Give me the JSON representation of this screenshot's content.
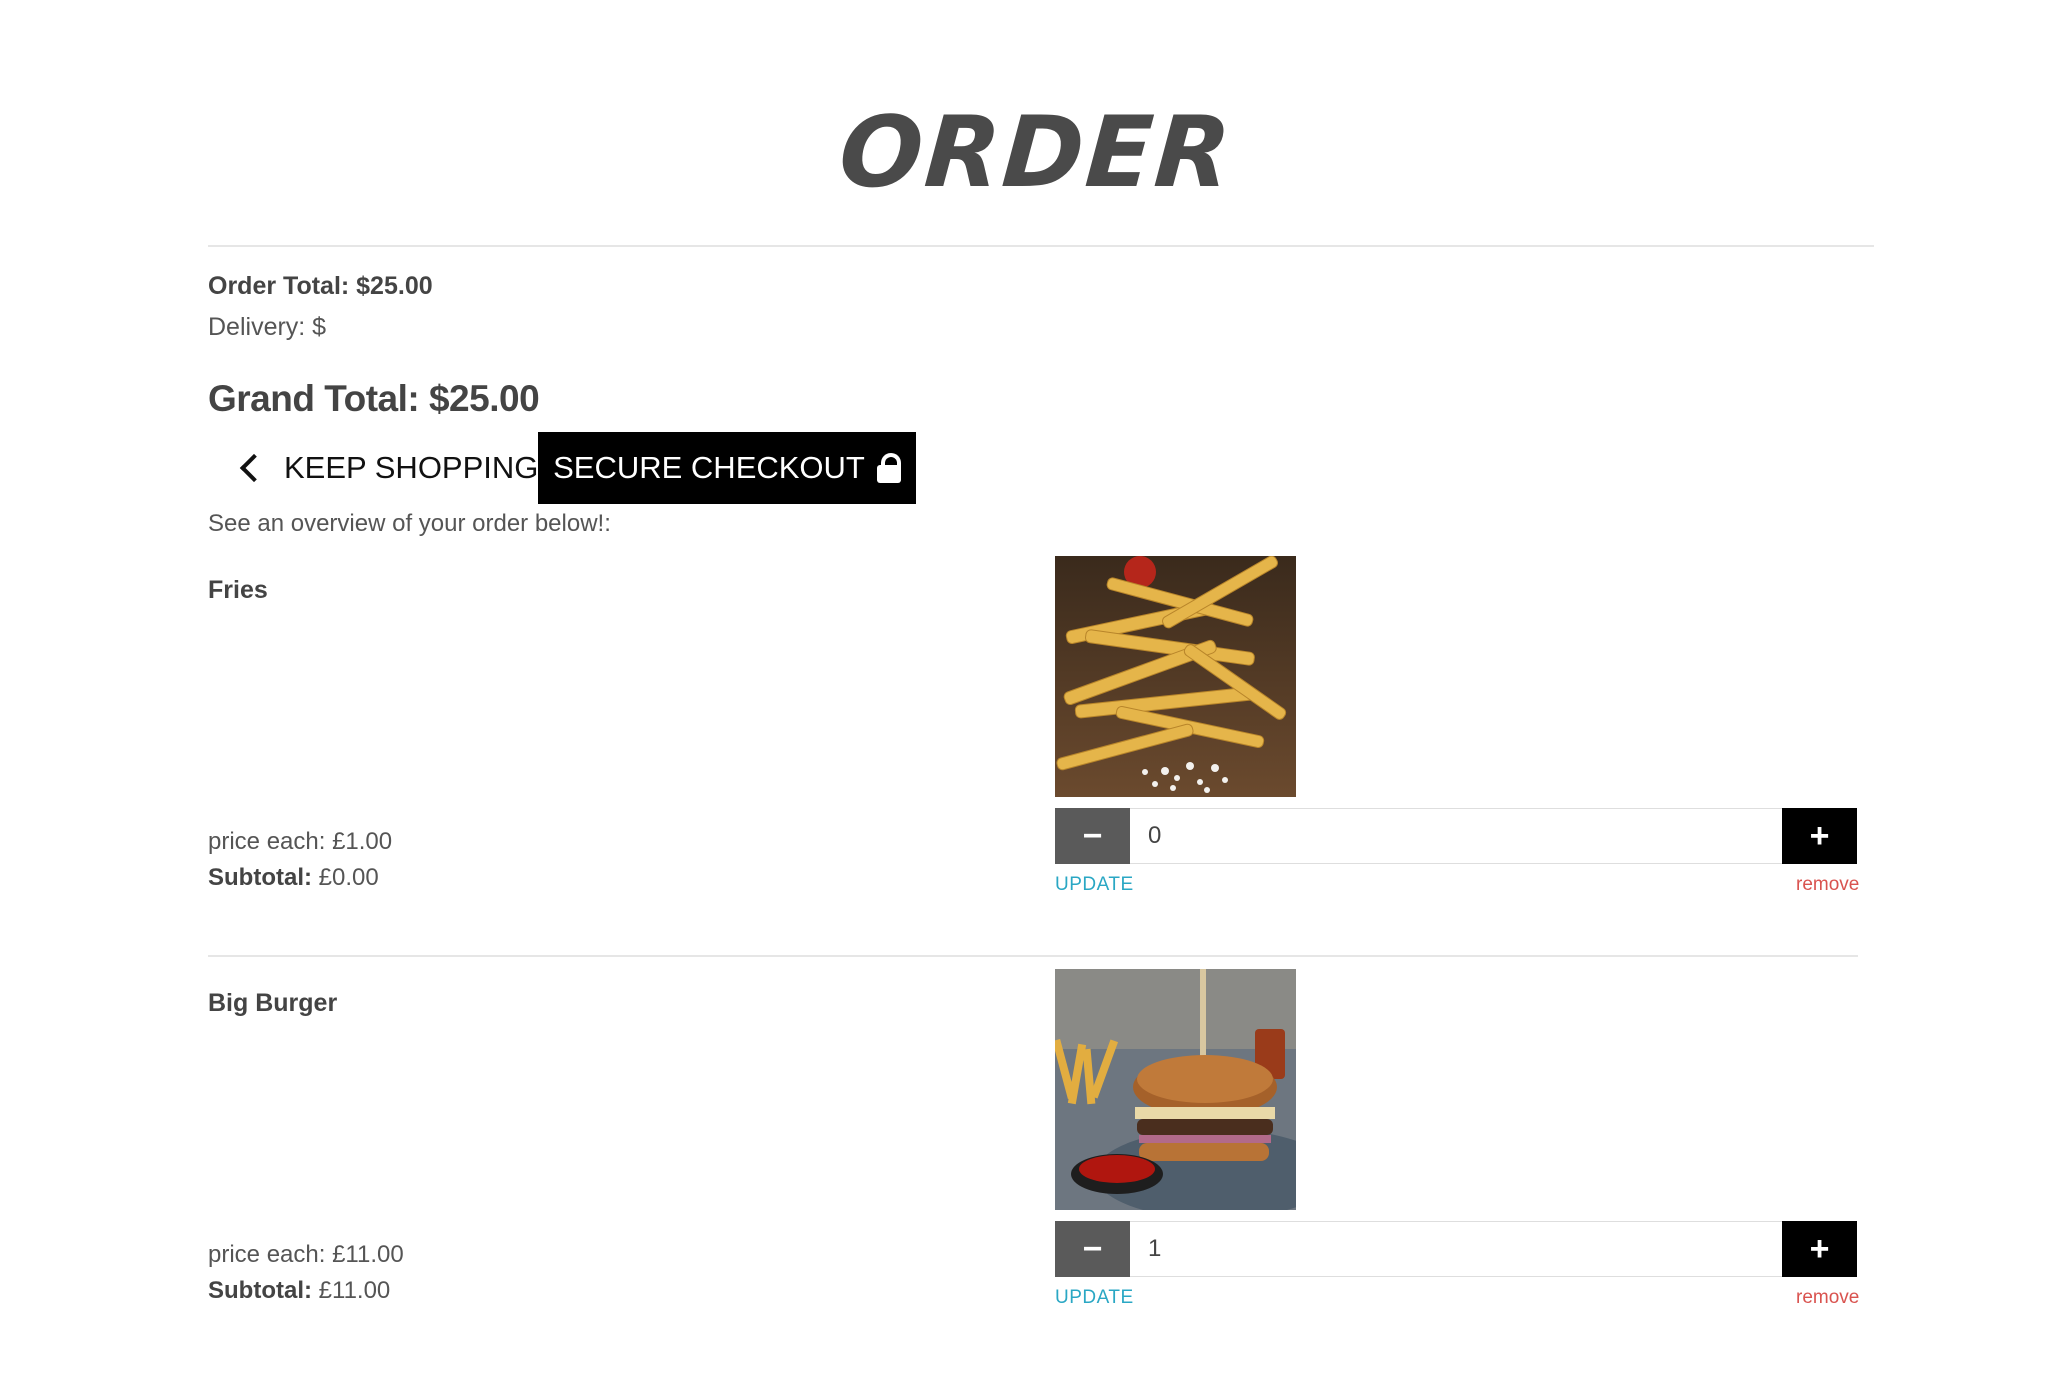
{
  "page": {
    "title": "ORDER"
  },
  "summary": {
    "order_total": "Order Total: $25.00",
    "delivery": "Delivery: $",
    "grand_total": "Grand Total: $25.00"
  },
  "actions": {
    "keep_shopping": "KEEP SHOPPING",
    "secure_checkout": "SECURE CHECKOUT"
  },
  "overview_text": "See an overview of your order below!:",
  "items": [
    {
      "name": "Fries",
      "price_each": "price each: £1.00",
      "subtotal_label": "Subtotal:",
      "subtotal_value": "£0.00",
      "quantity": "0",
      "update_label": "UPDATE",
      "remove_label": "remove"
    },
    {
      "name": "Big Burger",
      "price_each": "price each: £11.00",
      "subtotal_label": "Subtotal:",
      "subtotal_value": "£11.00",
      "quantity": "1",
      "update_label": "UPDATE",
      "remove_label": "remove"
    }
  ],
  "icons": {
    "back": "chevron-left-icon",
    "checkout": "lock-icon",
    "minus": "minus-icon",
    "plus": "plus-icon"
  },
  "colors": {
    "checkout_bg": "#000000",
    "minus_bg": "#5a5a5a",
    "plus_bg": "#000000",
    "update_link": "#2aa7c4",
    "remove_link": "#d9534f"
  }
}
